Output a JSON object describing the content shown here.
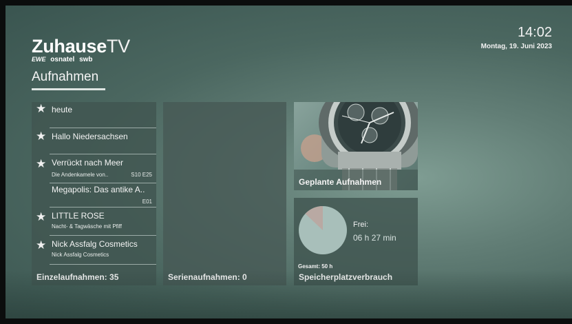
{
  "brand": {
    "title_bold": "Zuhause",
    "title_light": "TV",
    "partners": [
      "EWE",
      "osnatel",
      "swb"
    ]
  },
  "page_title": "Aufnahmen",
  "clock": {
    "time": "14:02",
    "date": "Montag, 19. Juni 2023"
  },
  "recordings": {
    "label": "Einzelaufnahmen: 35",
    "items": [
      {
        "title": "heute",
        "subtitle": "",
        "episode": "",
        "starred": true
      },
      {
        "title": "Hallo Niedersachsen",
        "subtitle": "",
        "episode": "",
        "starred": true
      },
      {
        "title": "Verrückt nach Meer",
        "subtitle": "Die Andenkamele von..",
        "episode": "S10 E25",
        "starred": true
      },
      {
        "title": "Megapolis: Das antike A..",
        "subtitle": "",
        "episode": "E01",
        "starred": false
      },
      {
        "title": "LITTLE ROSE",
        "subtitle": "Nacht- & Tagwäsche mit Pfiff",
        "episode": "",
        "starred": true
      },
      {
        "title": "Nick Assfalg Cosmetics",
        "subtitle": "Nick Assfalg Cosmetics",
        "episode": "",
        "starred": true
      }
    ]
  },
  "series": {
    "label": "Serienaufnahmen: 0"
  },
  "scheduled": {
    "label": "Geplante Aufnahmen"
  },
  "storage": {
    "label": "Speicherplatzverbrauch",
    "free_label": "Frei:",
    "free_value": "06 h 27 min",
    "total": "Gesamt: 50 h",
    "used_fraction": 0.13,
    "colors": {
      "free": "#a8bfba",
      "used": "#b9a9a3"
    }
  }
}
